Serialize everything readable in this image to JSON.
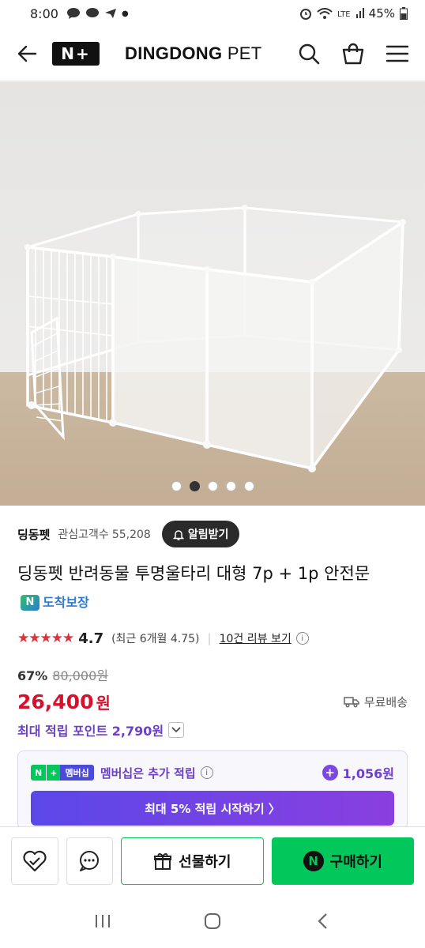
{
  "status_bar": {
    "time": "8:00",
    "battery": "45%"
  },
  "header": {
    "logo": "N+",
    "brand_bold": "DINGDONG",
    "brand_thin": " PET"
  },
  "gallery": {
    "slide_count": 5,
    "active_index": 1
  },
  "seller": {
    "name": "딩동펫",
    "fans_label": "관심고객수",
    "fans_count": "55,208",
    "alarm_label": "알림받기"
  },
  "product": {
    "title": "딩동펫 반려동물 투명울타리 대형 7p + 1p 안전문",
    "arrival_badge": "N",
    "arrival_label": "도착보장",
    "stars": "★★★★★",
    "rating": "4.7",
    "recent_rating": "(최근 6개월 4.75)",
    "review_link": "10건 리뷰 보기",
    "discount": "67%",
    "original_price": "80,000원",
    "price": "26,400",
    "currency": "원",
    "shipping": "무료배송",
    "max_points": "최대 적립 포인트 2,790원"
  },
  "membership": {
    "badge_n": "N",
    "badge_plus": "+",
    "badge_member": "멤버십",
    "text": "멤버십은 추가 적립",
    "points": "1,056원",
    "cta": "최대 5% 적립 시작하기 〉"
  },
  "actions": {
    "gift": "선물하기",
    "buy": "구매하기",
    "buy_badge": "N"
  },
  "colors": {
    "price_red": "#d8102c",
    "naver_green": "#02c75a",
    "points_purple": "#6b3fc9"
  }
}
